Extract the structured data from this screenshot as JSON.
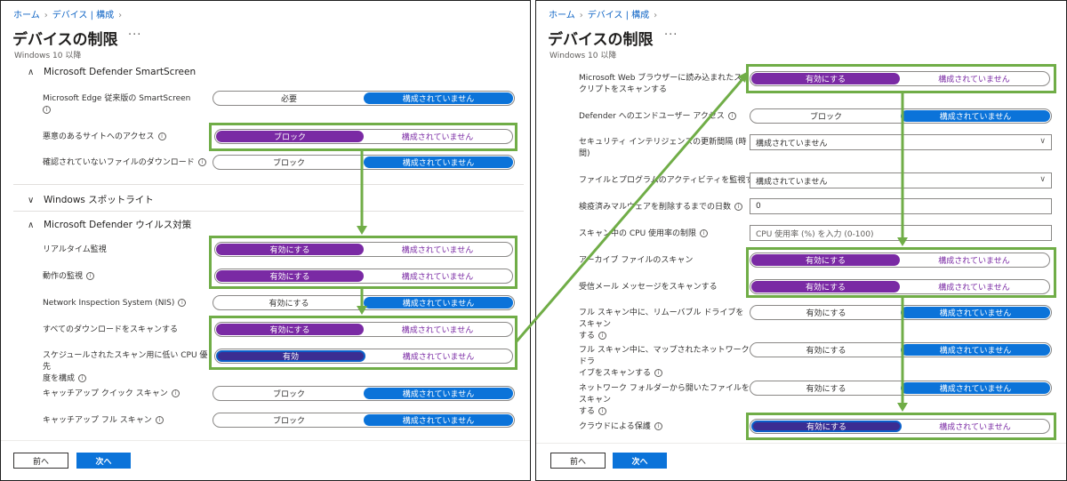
{
  "left": {
    "breadcrumb": {
      "home": "ホーム",
      "devices": "デバイス | 構成"
    },
    "title": "デバイスの制限",
    "more": "···",
    "subtitle": "Windows 10 以降",
    "sections": {
      "smartscreen": "Microsoft Defender SmartScreen",
      "spotlight": "Windows スポットライト",
      "antivirus": "Microsoft Defender ウイルス対策"
    },
    "settings": {
      "edge_smartscreen": {
        "label": "Microsoft Edge 従来版の SmartScreen",
        "opt1": "必要",
        "opt2": "構成されていません",
        "selected": "opt2"
      },
      "malicious_site": {
        "label": "悪意のあるサイトへのアクセス",
        "opt1": "ブロック",
        "opt2": "構成されていません",
        "selected": "opt1"
      },
      "unverified_download": {
        "label": "確認されていないファイルのダウンロード",
        "opt1": "ブロック",
        "opt2": "構成されていません",
        "selected": "opt2"
      },
      "realtime": {
        "label": "リアルタイム監視",
        "opt1": "有効にする",
        "opt2": "構成されていません",
        "selected": "opt1"
      },
      "behavior": {
        "label": "動作の監視",
        "opt1": "有効にする",
        "opt2": "構成されていません",
        "selected": "opt1"
      },
      "nis": {
        "label": "Network Inspection System (NIS)",
        "opt1": "有効にする",
        "opt2": "構成されていません",
        "selected": "opt2"
      },
      "scan_downloads": {
        "label": "すべてのダウンロードをスキャンする",
        "opt1": "有効にする",
        "opt2": "構成されていません",
        "selected": "opt1"
      },
      "low_cpu": {
        "label_line1": "スケジュールされたスキャン用に低い CPU 優先",
        "label_line2": "度を構成",
        "opt1": "有効",
        "opt2": "構成されていません",
        "selected": "opt1"
      },
      "catchup_quick": {
        "label": "キャッチアップ クイック スキャン",
        "opt1": "ブロック",
        "opt2": "構成されていません",
        "selected": "opt2"
      },
      "catchup_full": {
        "label": "キャッチアップ フル スキャン",
        "opt1": "ブロック",
        "opt2": "構成されていません",
        "selected": "opt2"
      }
    },
    "buttons": {
      "prev": "前へ",
      "next": "次へ"
    }
  },
  "right": {
    "breadcrumb": {
      "home": "ホーム",
      "devices": "デバイス | 構成"
    },
    "title": "デバイスの制限",
    "more": "···",
    "subtitle": "Windows 10 以降",
    "settings": {
      "web_scripts": {
        "label_line1": "Microsoft Web ブラウザーに読み込まれたス",
        "label_line2": "クリプトをスキャンする",
        "opt1": "有効にする",
        "opt2": "構成されていません",
        "selected": "opt1"
      },
      "end_user_access": {
        "label": "Defender へのエンドユーザー アクセス",
        "opt1": "ブロック",
        "opt2": "構成されていません",
        "selected": "opt2"
      },
      "update_interval": {
        "label_line1": "セキュリティ インテリジェンスの更新間隔 (時",
        "label_line2": "間)",
        "value": "構成されていません"
      },
      "monitor_activity": {
        "label": "ファイルとプログラムのアクティビティを監視する",
        "value": "構成されていません"
      },
      "quarantine_days": {
        "label": "検疫済みマルウェアを削除するまでの日数",
        "value": "0"
      },
      "cpu_limit": {
        "label": "スキャン中の CPU 使用率の制限",
        "placeholder": "CPU 使用率 (%) を入力 (0-100)"
      },
      "archive_scan": {
        "label": "アーカイブ ファイルのスキャン",
        "opt1": "有効にする",
        "opt2": "構成されていません",
        "selected": "opt1"
      },
      "email_scan": {
        "label": "受信メール メッセージをスキャンする",
        "opt1": "有効にする",
        "opt2": "構成されていません",
        "selected": "opt1"
      },
      "removable_scan": {
        "label_line1": "フル スキャン中に、リムーバブル ドライブをスキャン",
        "label_line2": "する",
        "opt1": "有効にする",
        "opt2": "構成されていません",
        "selected": "opt2"
      },
      "mapped_drive_scan": {
        "label_line1": "フル スキャン中に、マップされたネットワーク ドラ",
        "label_line2": "イブをスキャンする",
        "opt1": "有効にする",
        "opt2": "構成されていません",
        "selected": "opt2"
      },
      "network_folder_scan": {
        "label_line1": "ネットワーク フォルダーから開いたファイルをスキャン",
        "label_line2": "する",
        "opt1": "有効にする",
        "opt2": "構成されていません",
        "selected": "opt2"
      },
      "cloud_protection": {
        "label": "クラウドによる保護",
        "opt1": "有効にする",
        "opt2": "構成されていません",
        "selected": "opt1"
      }
    },
    "buttons": {
      "prev": "前へ",
      "next": "次へ"
    }
  },
  "colors": {
    "accent_blue": "#0b73d9",
    "selected_purple": "#7a2aa4",
    "highlight_green": "#70ad47"
  },
  "icons": {
    "info": "info-icon",
    "chevron_right": "chevron-right-icon",
    "chevron_up": "chevron-up-icon",
    "chevron_down": "chevron-down-icon"
  }
}
